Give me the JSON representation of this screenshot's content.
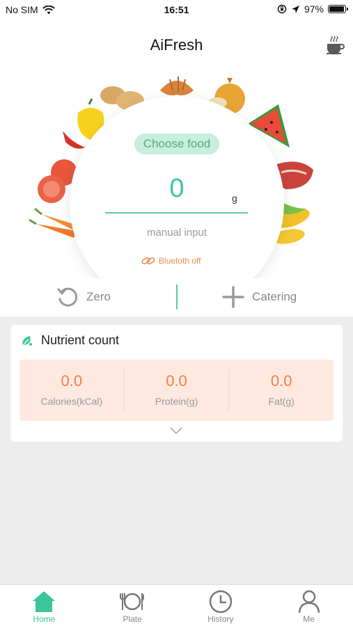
{
  "status": {
    "carrier": "No SIM",
    "time": "16:51",
    "battery": "97%",
    "battery_level": 0.97
  },
  "header": {
    "title": "AiFresh",
    "right_icon": "coffee-cup-icon"
  },
  "scale": {
    "choose_food": "Choose food",
    "weight": "0",
    "unit": "g",
    "manual_input": "manual input",
    "bluetooth": "Bluetoth off"
  },
  "actions": {
    "zero": "Zero",
    "catering": "Catering"
  },
  "nutrient": {
    "title": "Nutrient count",
    "items": [
      {
        "value": "0.0",
        "label": "Calories(kCal)"
      },
      {
        "value": "0.0",
        "label": "Protein(g)"
      },
      {
        "value": "0.0",
        "label": "Fat(g)"
      }
    ]
  },
  "tabs": [
    {
      "label": "Home",
      "icon": "home-icon",
      "active": true
    },
    {
      "label": "Plate",
      "icon": "plate-icon",
      "active": false
    },
    {
      "label": "History",
      "icon": "clock-icon",
      "active": false
    },
    {
      "label": "Me",
      "icon": "person-icon",
      "active": false
    }
  ],
  "colors": {
    "accent": "#3dc69c",
    "orange": "#f07f48",
    "nutrient_bg": "#fde9df"
  }
}
